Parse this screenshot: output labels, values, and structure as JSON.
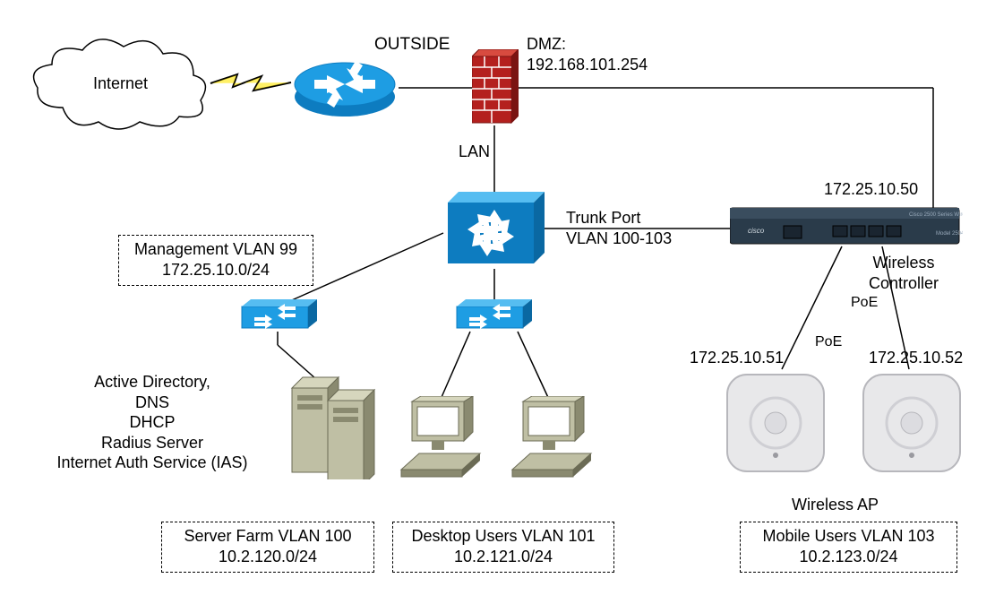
{
  "labels": {
    "internet": "Internet",
    "outside": "OUTSIDE",
    "dmz_title": "DMZ:",
    "dmz_ip": "192.168.101.254",
    "lan": "LAN",
    "mgmt_vlan_l1": "Management VLAN 99",
    "mgmt_vlan_l2": "172.25.10.0/24",
    "wlc_ip": "172.25.10.50",
    "wlc": "Wireless\nController",
    "trunk_l1": "Trunk Port",
    "trunk_l2": "VLAN 100-103",
    "poe": "PoE",
    "ap1_ip": "172.25.10.51",
    "ap2_ip": "172.25.10.52",
    "wap": "Wireless AP",
    "services": "Active Directory,\nDNS\nDHCP\nRadius Server\nInternet Auth Service (IAS)",
    "server_farm_l1": "Server Farm VLAN 100",
    "server_farm_l2": "10.2.120.0/24",
    "desktop_l1": "Desktop Users VLAN 101",
    "desktop_l2": "10.2.121.0/24",
    "mobile_l1": "Mobile Users VLAN 103",
    "mobile_l2": "10.2.123.0/24"
  },
  "colors": {
    "cisco_blue": "#1e9de3",
    "cisco_blue_dark": "#0d7cc0",
    "brick": "#b4201e",
    "brick_dark": "#7a1412",
    "beige": "#bfbfa4",
    "beige_dark": "#8a8a70",
    "wlc_body": "#2a3b4a",
    "ap_body": "#e8e8ea"
  }
}
